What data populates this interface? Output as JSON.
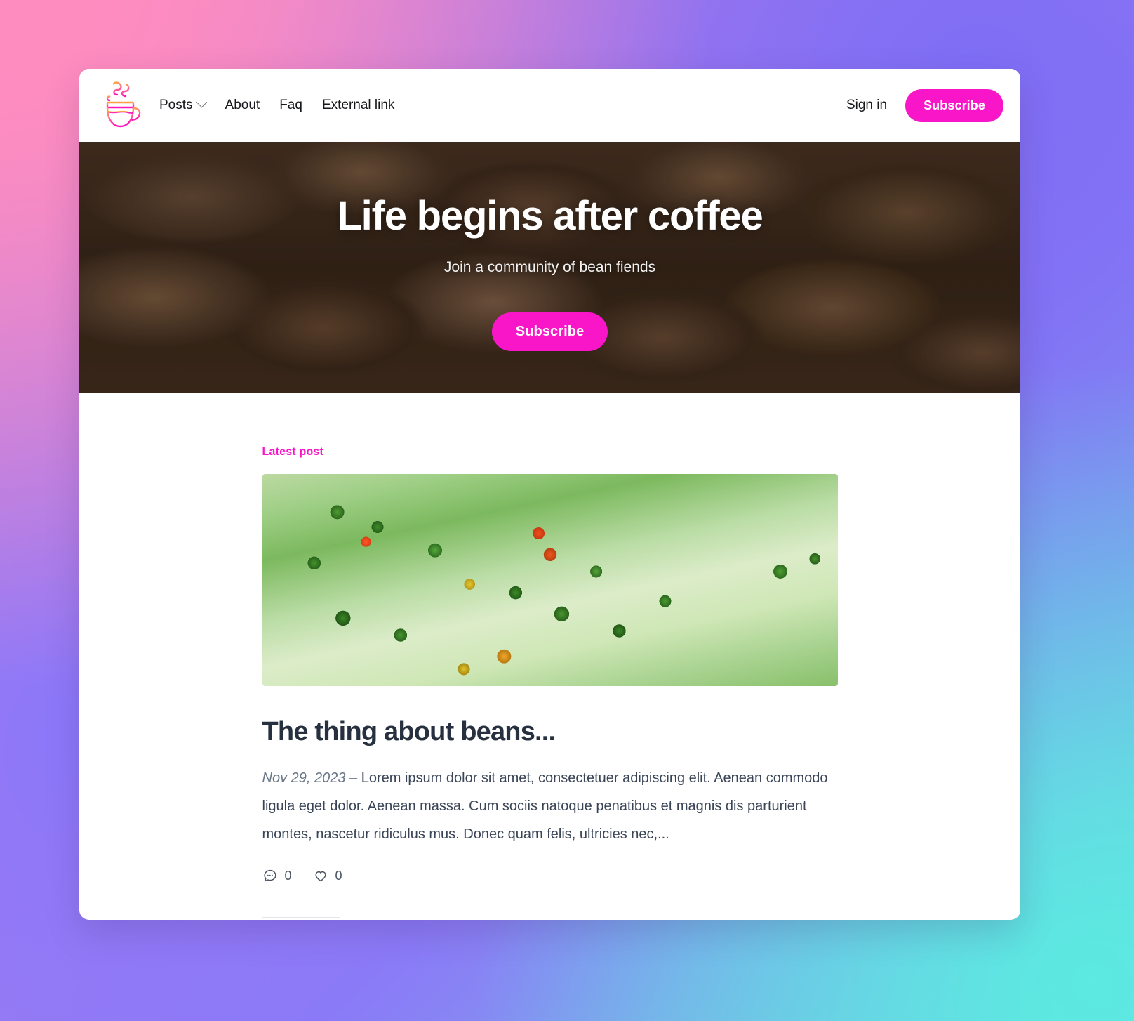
{
  "theme": {
    "accent_pink": "#f916c8",
    "text_dark": "#15171a",
    "title_dark": "#26303f",
    "body_text": "#394456",
    "logo_gradient_from": "#ff9d3c",
    "logo_gradient_to": "#ff14be",
    "page_bg_from": "#ff8fc8",
    "page_bg_to": "#6fd8e0"
  },
  "nav": {
    "logo_name": "coffee-cup-logo",
    "links": [
      {
        "label": "Posts",
        "has_dropdown": true
      },
      {
        "label": "About",
        "has_dropdown": false
      },
      {
        "label": "Faq",
        "has_dropdown": false
      },
      {
        "label": "External link",
        "has_dropdown": false
      }
    ],
    "signin_label": "Sign in",
    "subscribe_label": "Subscribe"
  },
  "hero": {
    "title": "Life begins after coffee",
    "subtitle": "Join a community of bean fiends",
    "cta_label": "Subscribe",
    "background_image_alt": "roasted-coffee-beans-photo"
  },
  "main": {
    "latest_label": "Latest post",
    "post": {
      "image_alt": "coffee-cherries-on-branch-photo",
      "title": "The thing about beans...",
      "date": "Nov 29, 2023",
      "date_separator": " – ",
      "excerpt": "Lorem ipsum dolor sit amet, consectetuer adipiscing elit. Aenean commodo ligula eget dolor. Aenean massa. Cum sociis natoque penatibus et magnis dis parturient montes, nascetur ridiculus mus. Donec quam felis, ultricies nec,...",
      "comment_count": "0",
      "like_count": "0"
    }
  }
}
